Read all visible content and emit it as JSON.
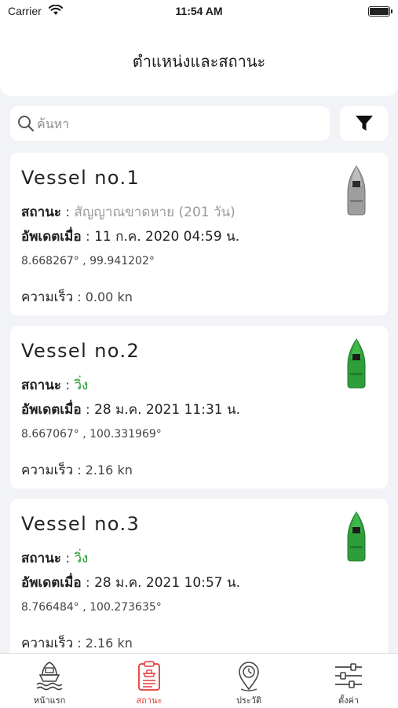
{
  "status_bar": {
    "carrier": "Carrier",
    "time": "11:54 AM"
  },
  "header": {
    "title": "ตำแหน่งและสถานะ"
  },
  "search": {
    "placeholder": "ค้นหา",
    "value": ""
  },
  "vessels": [
    {
      "name": "Vessel no.1",
      "status_label": "สถานะ",
      "status": "สัญญาณขาดหาย (201 วัน)",
      "status_type": "lost",
      "update_label": "อัพเดตเมื่อ",
      "updated": "11 ก.ค. 2020 04:59 น.",
      "coords": "8.668267° , 99.941202°",
      "speed_label": "ความเร็ว",
      "speed": "0.00 kn",
      "boat_color": "#9e9e9e"
    },
    {
      "name": "Vessel no.2",
      "status_label": "สถานะ",
      "status": "วิ่ง",
      "status_type": "running",
      "update_label": "อัพเดตเมื่อ",
      "updated": "28 ม.ค. 2021 11:31 น.",
      "coords": "8.667067° , 100.331969°",
      "speed_label": "ความเร็ว",
      "speed": "2.16 kn",
      "boat_color": "#2e9e3a"
    },
    {
      "name": "Vessel no.3",
      "status_label": "สถานะ",
      "status": "วิ่ง",
      "status_type": "running",
      "update_label": "อัพเดตเมื่อ",
      "updated": "28 ม.ค. 2021 10:57 น.",
      "coords": "8.766484° , 100.273635°",
      "speed_label": "ความเร็ว",
      "speed": "2.16 kn",
      "boat_color": "#2e9e3a"
    }
  ],
  "tabs": [
    {
      "label": "หน้าแรก",
      "icon": "ship-waves-icon",
      "active": false
    },
    {
      "label": "สถานะ",
      "icon": "clipboard-ship-icon",
      "active": true
    },
    {
      "label": "ประวัติ",
      "icon": "map-pin-clock-icon",
      "active": false
    },
    {
      "label": "ตั้งค่า",
      "icon": "sliders-icon",
      "active": false
    }
  ],
  "colors": {
    "accent": "#e53935",
    "running": "#1e9a2a",
    "lost": "#9a9a9a",
    "background": "#f2f3f7"
  }
}
